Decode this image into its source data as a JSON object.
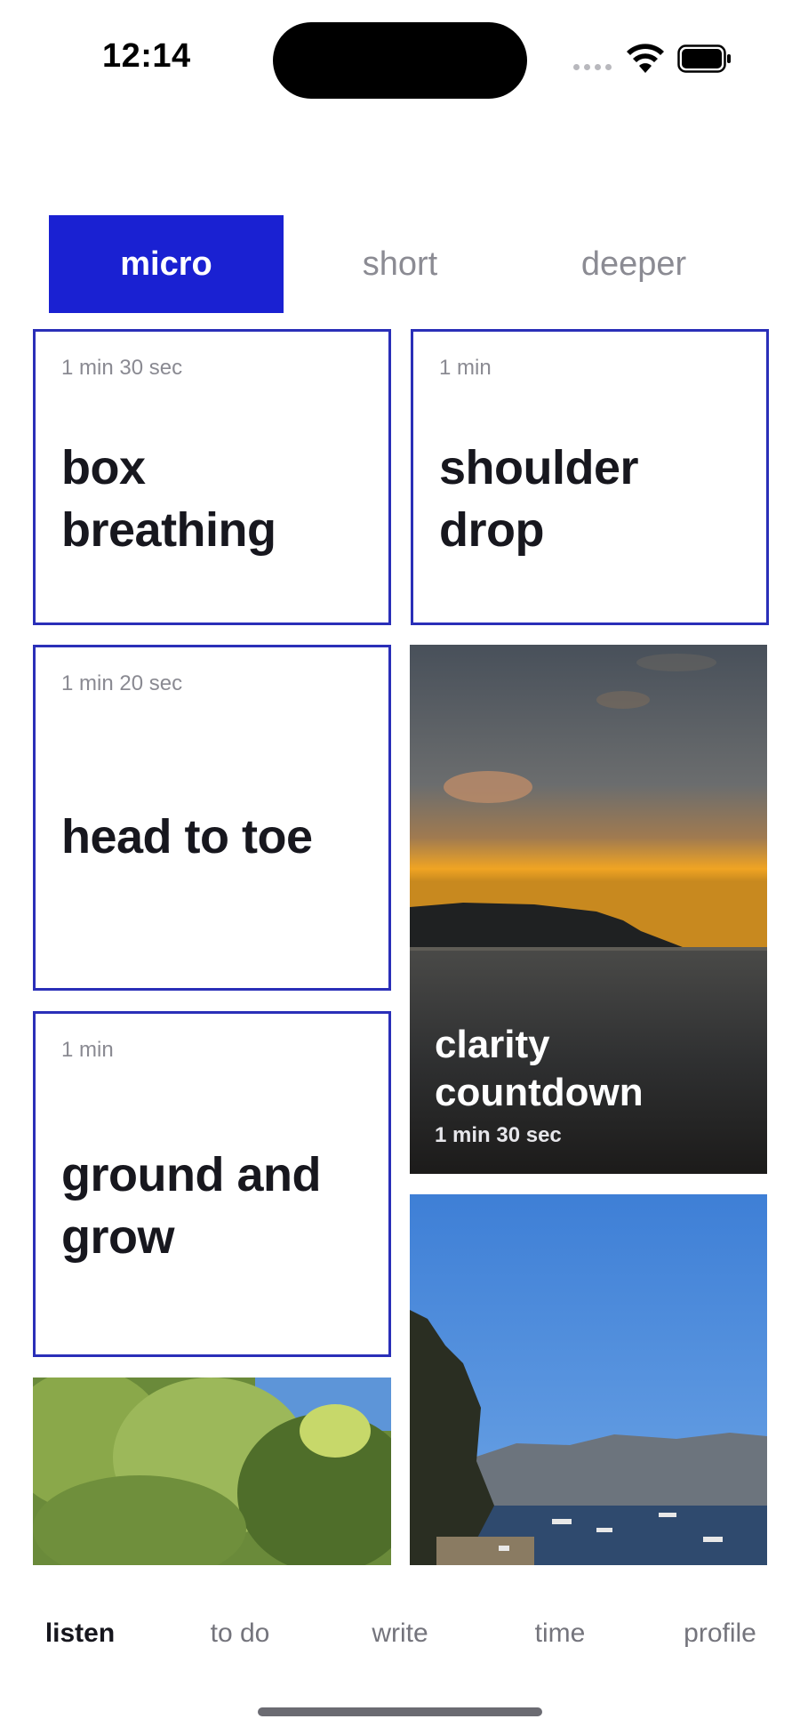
{
  "status": {
    "time": "12:14"
  },
  "tabs": [
    {
      "label": "micro",
      "active": true
    },
    {
      "label": "short",
      "active": false
    },
    {
      "label": "deeper",
      "active": false
    }
  ],
  "cards": [
    {
      "duration": "1 min 30 sec",
      "title": "box breathing"
    },
    {
      "duration": "1 min",
      "title": "shoulder drop"
    },
    {
      "duration": "1 min 20 sec",
      "title": "head to toe"
    },
    {
      "title": "clarity countdown",
      "duration": "1 min 30 sec"
    },
    {
      "duration": "1 min",
      "title": "ground and grow"
    }
  ],
  "nav": [
    {
      "label": "listen",
      "active": true
    },
    {
      "label": "to do",
      "active": false
    },
    {
      "label": "write",
      "active": false
    },
    {
      "label": "time",
      "active": false
    },
    {
      "label": "profile",
      "active": false
    }
  ],
  "colors": {
    "accent": "#1a21d2",
    "card_border": "#2a2fb8",
    "text": "#16161d",
    "muted": "#8a8a92"
  }
}
